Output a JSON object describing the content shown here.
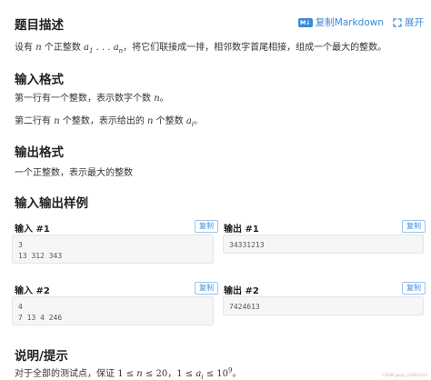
{
  "toolbar": {
    "copy_markdown_label": "复制Markdown",
    "expand_label": "展开"
  },
  "description": {
    "title": "题目描述",
    "text_prefix": "设有 ",
    "n": "n",
    "text_mid": " 个正整数 ",
    "text_suffix": "，将它们联接成一排，相邻数字首尾相接，组成一个最大的整数。"
  },
  "input_format": {
    "title": "输入格式",
    "line1_prefix": "第一行有一个整数，表示数字个数 ",
    "line2_prefix": "第二行有 ",
    "line2_mid": " 个整数，表示给出的 ",
    "line2_mid2": " 个整数 "
  },
  "output_format": {
    "title": "输出格式",
    "text": "一个正整数，表示最大的整数"
  },
  "samples": {
    "title": "输入输出样例",
    "copy_label": "复制",
    "items": [
      {
        "input_label": "输入 #1",
        "input": "3\n13 312 343",
        "output_label": "输出 #1",
        "output": "34331213"
      },
      {
        "input_label": "输入 #2",
        "input": "4\n7 13 4 246",
        "output_label": "输出 #2",
        "output": "7424613"
      }
    ]
  },
  "hint": {
    "title": "说明/提示",
    "text_prefix": "对于全部的测试点，保证 ",
    "text_mid": "，",
    "text_suffix": "。"
  },
  "watermark": "CSDN @qq_33491193"
}
